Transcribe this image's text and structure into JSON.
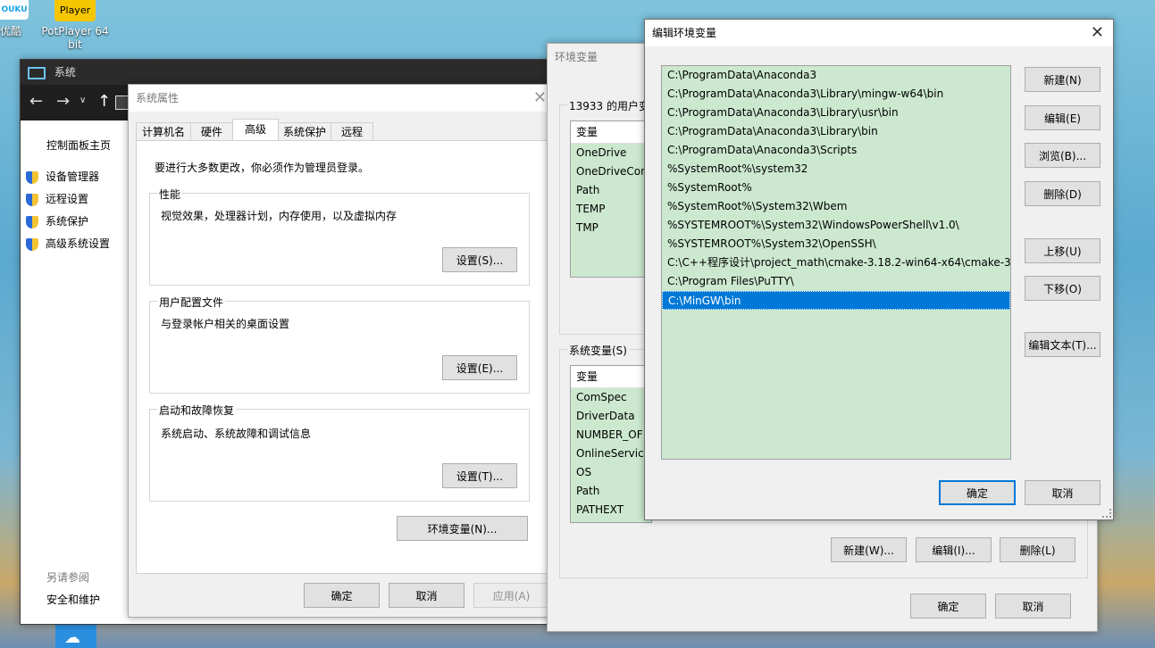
{
  "desktop": {
    "icons": [
      {
        "label": "优酷",
        "cap": "OUKU"
      },
      {
        "label": "PotPlayer 64\nbit",
        "cap": "Player"
      }
    ]
  },
  "system_window": {
    "title": "系统",
    "sidebar_title": "控制面板主页",
    "links": [
      "设备管理器",
      "远程设置",
      "系统保护",
      "高级系统设置"
    ],
    "see_also": "另请参阅",
    "security": "安全和维护"
  },
  "sysprops": {
    "title": "系统属性",
    "tabs": [
      "计算机名",
      "硬件",
      "高级",
      "系统保护",
      "远程"
    ],
    "active_tab": "高级",
    "admin_note": "要进行大多数更改，你必须作为管理员登录。",
    "perf_legend": "性能",
    "perf_desc": "视觉效果，处理器计划，内存使用，以及虚拟内存",
    "perf_btn": "设置(S)...",
    "profile_legend": "用户配置文件",
    "profile_desc": "与登录帐户相关的桌面设置",
    "profile_btn": "设置(E)...",
    "startup_legend": "启动和故障恢复",
    "startup_desc": "系统启动、系统故障和调试信息",
    "startup_btn": "设置(T)...",
    "env_btn": "环境变量(N)...",
    "ok": "确定",
    "cancel": "取消",
    "apply": "应用(A)"
  },
  "envvars": {
    "title": "环境变量",
    "user_label": "13933 的用户变",
    "user_header": "变量",
    "user_vars": [
      "OneDrive",
      "OneDriveCon",
      "Path",
      "TEMP",
      "TMP"
    ],
    "sys_label": "系统变量(S)",
    "sys_header": "变量",
    "sys_vars": [
      "ComSpec",
      "DriverData",
      "NUMBER_OF",
      "OnlineService",
      "OS",
      "Path",
      "PATHEXT"
    ],
    "new_btn": "新建(W)...",
    "edit_btn": "编辑(I)...",
    "del_btn": "删除(L)",
    "ok": "确定",
    "cancel": "取消"
  },
  "editenv": {
    "title": "编辑环境变量",
    "paths": [
      "C:\\ProgramData\\Anaconda3",
      "C:\\ProgramData\\Anaconda3\\Library\\mingw-w64\\bin",
      "C:\\ProgramData\\Anaconda3\\Library\\usr\\bin",
      "C:\\ProgramData\\Anaconda3\\Library\\bin",
      "C:\\ProgramData\\Anaconda3\\Scripts",
      "%SystemRoot%\\system32",
      "%SystemRoot%",
      "%SystemRoot%\\System32\\Wbem",
      "%SYSTEMROOT%\\System32\\WindowsPowerShell\\v1.0\\",
      "%SYSTEMROOT%\\System32\\OpenSSH\\",
      "C:\\C++程序设计\\project_math\\cmake-3.18.2-win64-x64\\cmake-3...",
      "C:\\Program Files\\PuTTY\\",
      "C:\\MinGW\\bin"
    ],
    "selected_index": 12,
    "buttons": {
      "new": "新建(N)",
      "edit": "编辑(E)",
      "browse": "浏览(B)...",
      "delete": "删除(D)",
      "up": "上移(U)",
      "down": "下移(O)",
      "edit_text": "编辑文本(T)..."
    },
    "ok": "确定",
    "cancel": "取消"
  },
  "colors": {
    "list_bg": "#cce8cf",
    "selection": "#0078d7",
    "dialog_bg": "#f0f0f0"
  }
}
